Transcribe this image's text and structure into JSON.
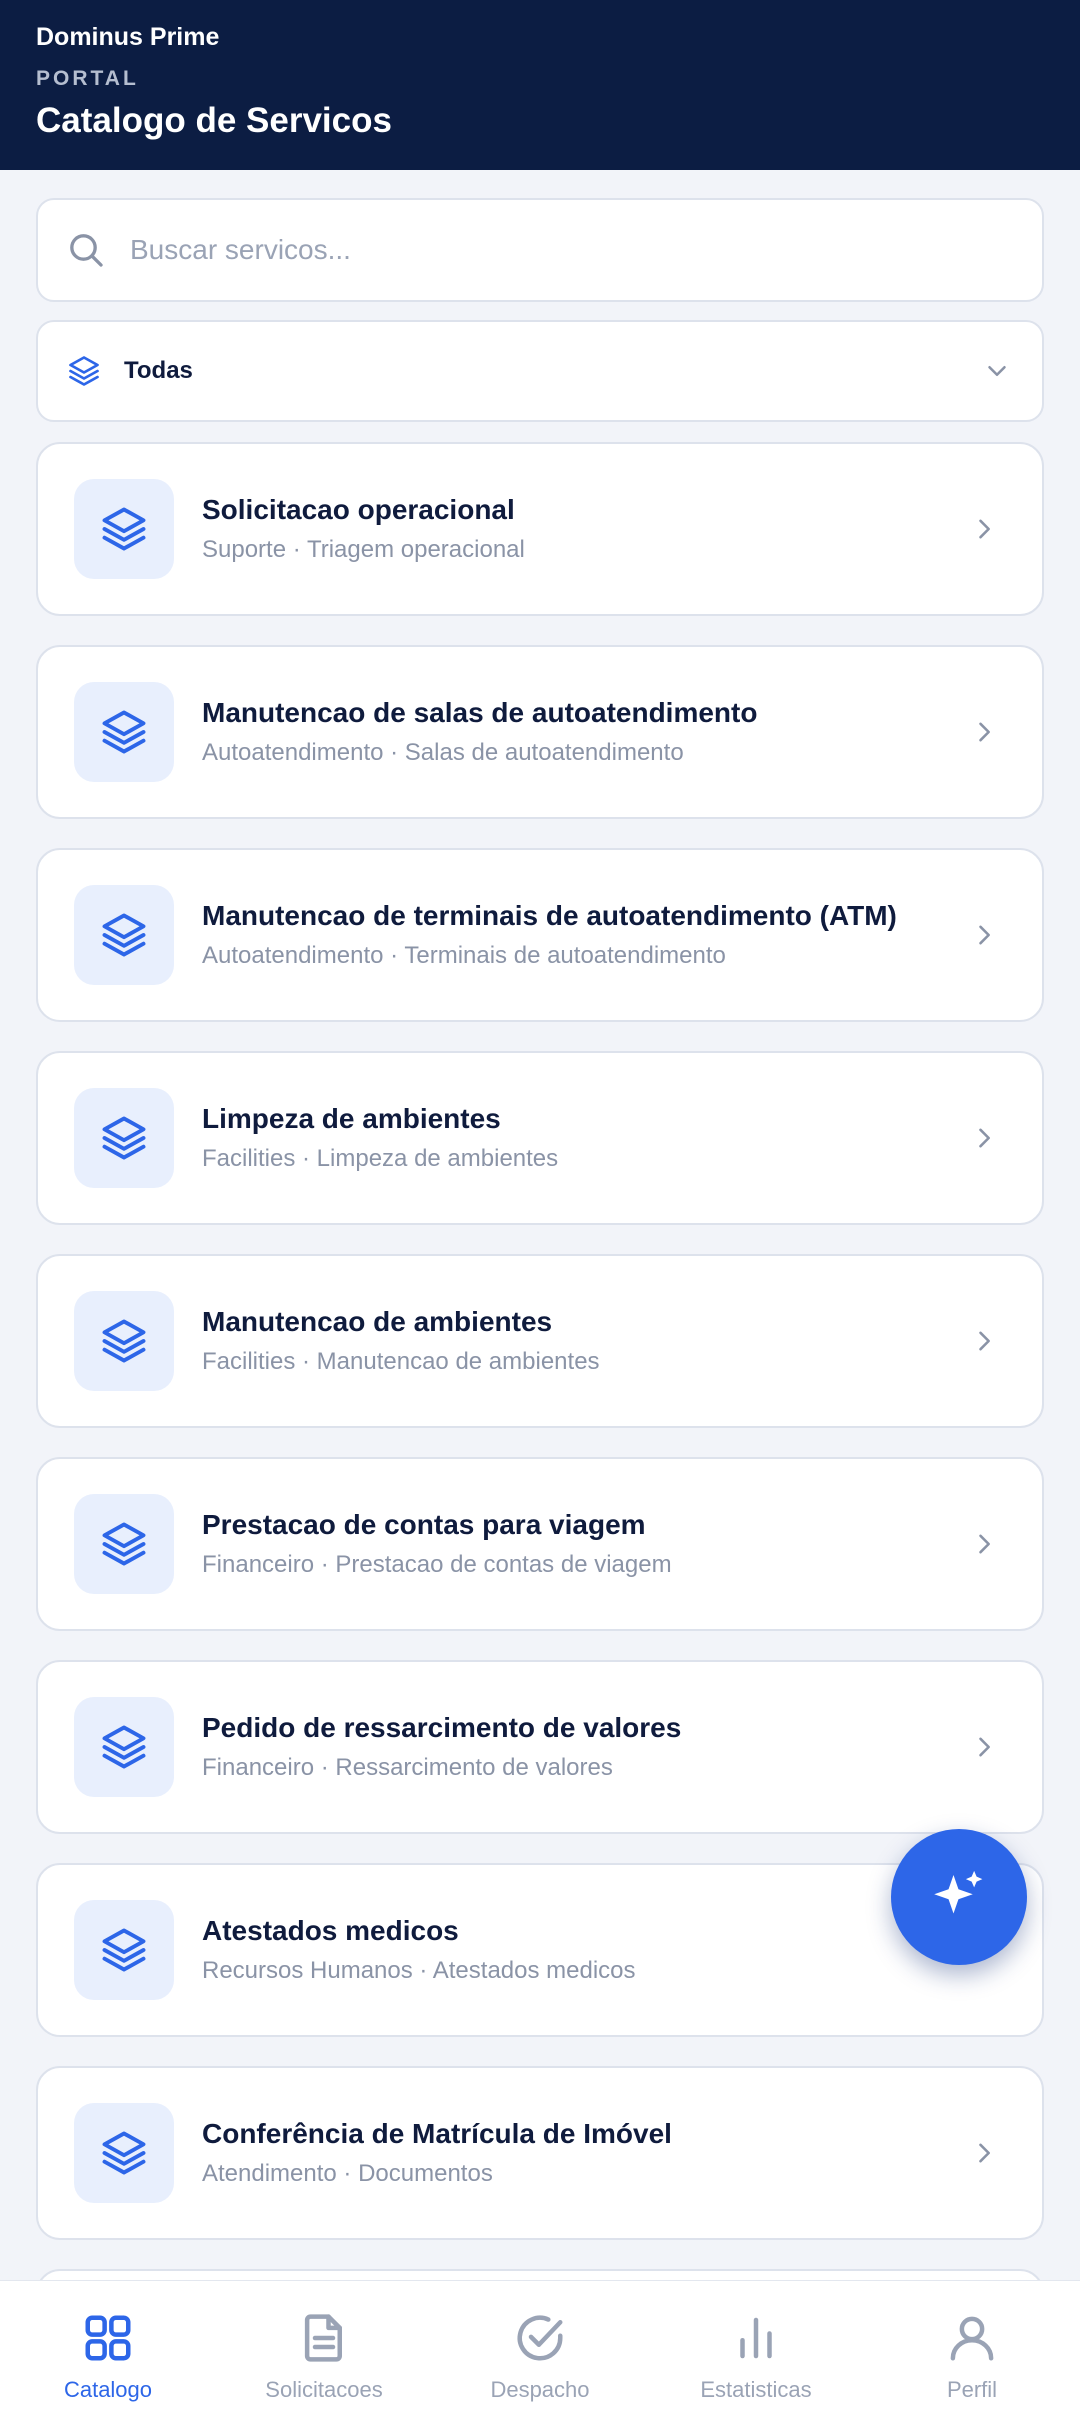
{
  "header": {
    "org_name": "Dominus Prime",
    "section": "PORTAL",
    "title": "Catalogo de Servicos"
  },
  "search": {
    "placeholder": "Buscar servicos...",
    "value": "",
    "icon": "search-icon"
  },
  "filter": {
    "icon": "layers-icon",
    "selected": "Todas",
    "chevron_icon": "chevron-down-icon"
  },
  "services": [
    {
      "name": "Solicitacao operacional",
      "subtitle": "Suporte · Triagem operacional"
    },
    {
      "name": "Manutencao de salas de autoatendimento",
      "subtitle": "Autoatendimento · Salas de autoatendimento"
    },
    {
      "name": "Manutencao de terminais de autoatendimento (ATM)",
      "subtitle": "Autoatendimento · Terminais de autoatendimento"
    },
    {
      "name": "Limpeza de ambientes",
      "subtitle": "Facilities · Limpeza de ambientes"
    },
    {
      "name": "Manutencao de ambientes",
      "subtitle": "Facilities · Manutencao de ambientes"
    },
    {
      "name": "Prestacao de contas para viagem",
      "subtitle": "Financeiro · Prestacao de contas de viagem"
    },
    {
      "name": "Pedido de ressarcimento de valores",
      "subtitle": "Financeiro · Ressarcimento de valores"
    },
    {
      "name": "Atestados medicos",
      "subtitle": "Recursos Humanos · Atestados medicos"
    },
    {
      "name": "Conferência de Matrícula de Imóvel",
      "subtitle": "Atendimento · Documentos"
    }
  ],
  "fab": {
    "icon": "sparkles-icon"
  },
  "bottom_nav": [
    {
      "label": "Catalogo",
      "icon": "grid-icon",
      "active": true
    },
    {
      "label": "Solicitacoes",
      "icon": "document-icon",
      "active": false
    },
    {
      "label": "Despacho",
      "icon": "check-circle-icon",
      "active": false
    },
    {
      "label": "Estatisticas",
      "icon": "bar-chart-icon",
      "active": false
    },
    {
      "label": "Perfil",
      "icon": "user-icon",
      "active": false
    }
  ],
  "colors": {
    "header_bg": "#0c1d43",
    "accent": "#2d66e8",
    "icon_tile_bg": "#e8effd",
    "muted_text": "#8a93a6"
  }
}
